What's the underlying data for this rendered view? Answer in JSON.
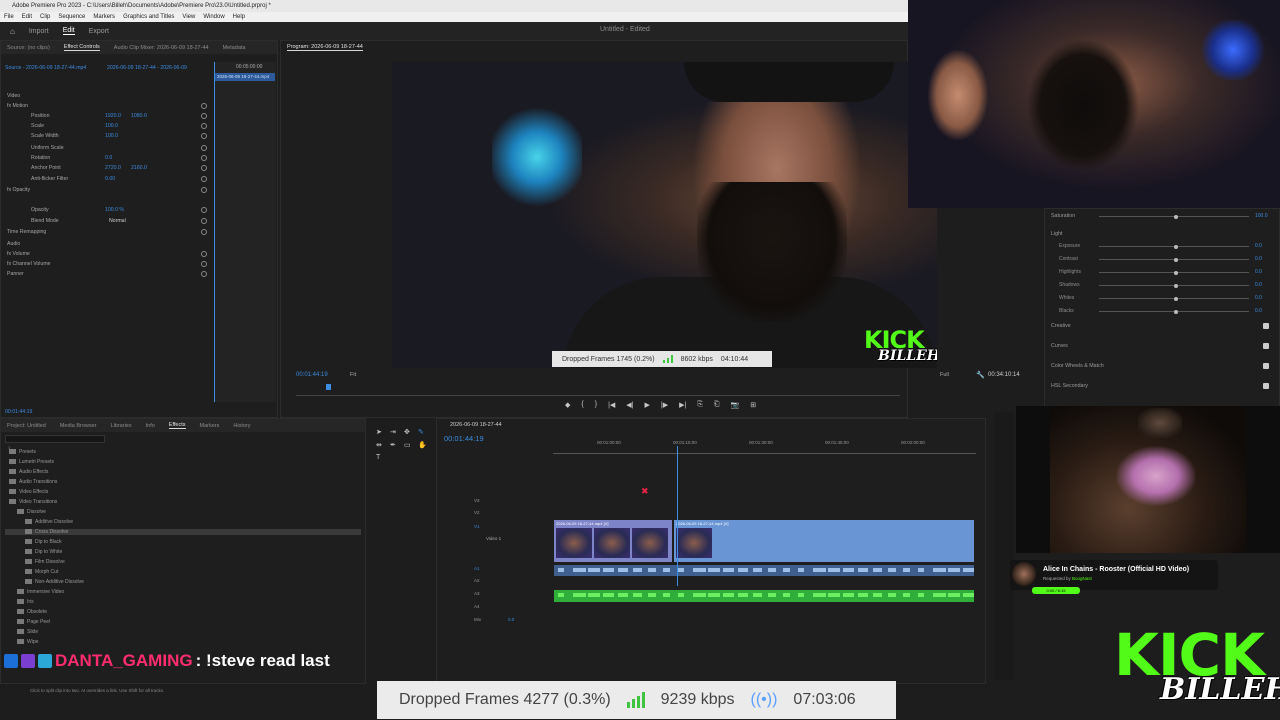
{
  "window": {
    "title": "Adobe Premiere Pro 2023 - C:\\Users\\Billeh\\Documents\\Adobe\\Premiere Pro\\23.0\\Untitled.prproj *",
    "doc_title": "Untitled - Edited"
  },
  "menu": [
    "File",
    "Edit",
    "Clip",
    "Sequence",
    "Markers",
    "Graphics and Titles",
    "View",
    "Window",
    "Help"
  ],
  "workspaces": [
    "Import",
    "Edit",
    "Export"
  ],
  "effect_controls": {
    "tabs": [
      "Source: (no clips)",
      "Effect Controls",
      "Audio Clip Mixer: 2026-06-09 18-27-44",
      "Metadata"
    ],
    "source_label": "Source - 2026-06-09 18-27-44.mp4",
    "clip_label": "2026-06-09 18-27-44 - 2026-06-09",
    "timecode_top": "00:05:00:00",
    "timeline_clip": "2026-06-09 18-27-44.mp4",
    "current_time": "00:01:44:19",
    "rows": [
      {
        "label": "Video",
        "v1": "",
        "v2": ""
      },
      {
        "label": "fx  Motion",
        "v1": "",
        "v2": ""
      },
      {
        "label": "Position",
        "v1": "1920.0",
        "v2": "1080.0"
      },
      {
        "label": "Scale",
        "v1": "100.0",
        "v2": ""
      },
      {
        "label": "Scale Width",
        "v1": "100.0",
        "v2": ""
      },
      {
        "label": "Uniform Scale",
        "v1": "",
        "v2": ""
      },
      {
        "label": "Rotation",
        "v1": "0.0",
        "v2": ""
      },
      {
        "label": "Anchor Point",
        "v1": "2720.0",
        "v2": "2160.0"
      },
      {
        "label": "Anti-flicker Filter",
        "v1": "0.00",
        "v2": ""
      },
      {
        "label": "fx  Opacity",
        "v1": "",
        "v2": ""
      },
      {
        "label": "Opacity",
        "v1": "100.0 %",
        "v2": ""
      },
      {
        "label": "Blend Mode",
        "v1": "Normal",
        "v2": ""
      },
      {
        "label": "Time Remapping",
        "v1": "",
        "v2": ""
      },
      {
        "label": "Audio",
        "v1": "",
        "v2": ""
      },
      {
        "label": "fx  Volume",
        "v1": "",
        "v2": ""
      },
      {
        "label": "fx  Channel Volume",
        "v1": "",
        "v2": ""
      },
      {
        "label": "Panner",
        "v1": "",
        "v2": ""
      }
    ]
  },
  "program": {
    "tab": "Program: 2026-06-09 18-27-44",
    "timecode": "00:01:44:19",
    "fit": "Fit",
    "full": "Full",
    "duration": "00:34:10:14",
    "overlay": {
      "dropped": "Dropped Frames 1745 (0.2%)",
      "kbps": "8602 kbps",
      "time": "04:10:44"
    },
    "transport": [
      "◆",
      "{",
      "}",
      "|◀",
      "◀|",
      "▶",
      "|▶",
      "▶|",
      "⎘",
      "⎗",
      "📷",
      "⊞"
    ]
  },
  "lumetri": {
    "sections": [
      {
        "label": "Saturation",
        "value": "100.0"
      },
      {
        "label": "Light",
        "value": ""
      }
    ],
    "sliders": [
      {
        "label": "Exposure",
        "value": "0.0"
      },
      {
        "label": "Contrast",
        "value": "0.0"
      },
      {
        "label": "Highlights",
        "value": "0.0"
      },
      {
        "label": "Shadows",
        "value": "0.0"
      },
      {
        "label": "Whites",
        "value": "0.0"
      },
      {
        "label": "Blacks",
        "value": "0.0"
      }
    ],
    "groups": [
      "Creative",
      "Curves",
      "Color Wheels & Match",
      "HSL Secondary"
    ]
  },
  "project": {
    "tabs": [
      "Project: Untitled",
      "Media Browser",
      "Libraries",
      "Info",
      "Effects",
      "Markers",
      "History"
    ],
    "tree": [
      {
        "label": "Presets",
        "indent": 0
      },
      {
        "label": "Lumetri Presets",
        "indent": 0
      },
      {
        "label": "Audio Effects",
        "indent": 0
      },
      {
        "label": "Audio Transitions",
        "indent": 0
      },
      {
        "label": "Video Effects",
        "indent": 0
      },
      {
        "label": "Video Transitions",
        "indent": 0
      },
      {
        "label": "Dissolve",
        "indent": 1
      },
      {
        "label": "Additive Dissolve",
        "indent": 2
      },
      {
        "label": "Cross Dissolve",
        "indent": 2
      },
      {
        "label": "Dip to Black",
        "indent": 2
      },
      {
        "label": "Dip to White",
        "indent": 2
      },
      {
        "label": "Film Dissolve",
        "indent": 2
      },
      {
        "label": "Morph Cut",
        "indent": 2
      },
      {
        "label": "Non-Additive Dissolve",
        "indent": 2
      },
      {
        "label": "Immersive Video",
        "indent": 1
      },
      {
        "label": "Iris",
        "indent": 1
      },
      {
        "label": "Obsolete",
        "indent": 1
      },
      {
        "label": "Page Peel",
        "indent": 1
      },
      {
        "label": "Slide",
        "indent": 1
      },
      {
        "label": "Wipe",
        "indent": 1
      }
    ]
  },
  "chat": {
    "username": "DANTA_GAMING",
    "message": ": !steve read last"
  },
  "timeline": {
    "sequence": "2026-06-09 18-27-44",
    "timecode": "00:01:44:19",
    "ruler": [
      "00:01:00:00",
      "00:01:15:00",
      "00:01:30:00",
      "00:01:45:00",
      "00:02:00:00"
    ],
    "tracks": [
      "V3",
      "V2",
      "V1",
      "A1",
      "A2",
      "A3",
      "A4",
      "Mix"
    ],
    "track_name_v1": "Video 1",
    "mix_value": "0.0",
    "clip_a": "2026-06-09 18-27-44.mp4 [V]",
    "clip_b": "2026-06-09 18-27-44.mp4 [V]"
  },
  "song": {
    "title": "Alice In Chains - Rooster (Official HD Video)",
    "requested_prefix": "Requested by ",
    "requested_by": "BoogNast",
    "pill": "0:00 / 6:15"
  },
  "stats": {
    "dropped": "Dropped Frames 4277 (0.3%)",
    "kbps": "9239 kbps",
    "time": "07:03:06"
  },
  "status_text": "Click to split clip into two. At overrides a link. Use Shift for all tracks.",
  "brand": {
    "kick": "KICK",
    "name": "BILLEH",
    "accent": "#53fc18"
  }
}
